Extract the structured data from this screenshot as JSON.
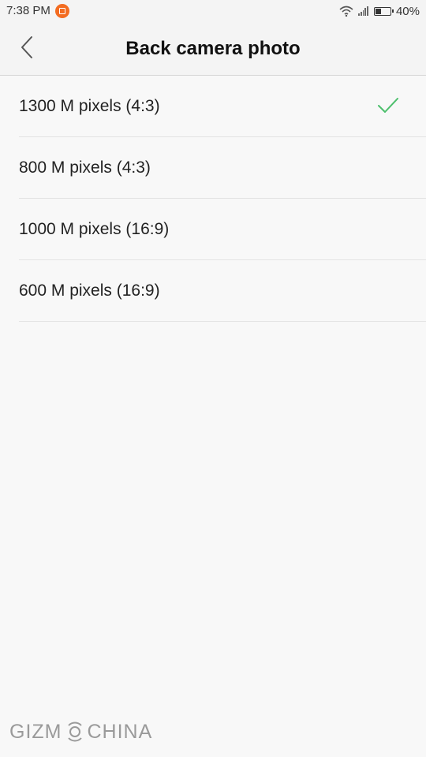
{
  "status_bar": {
    "time": "7:38 PM",
    "notification_icon": "app-notification-icon",
    "battery_percent_label": "40%",
    "battery_level": 0.4
  },
  "header": {
    "back_icon": "chevron-left-icon",
    "title": "Back camera photo"
  },
  "options": [
    {
      "label": "1300 M pixels (4:3)",
      "selected": true
    },
    {
      "label": "800 M pixels (4:3)",
      "selected": false
    },
    {
      "label": "1000 M pixels (16:9)",
      "selected": false
    },
    {
      "label": "600 M pixels (16:9)",
      "selected": false
    }
  ],
  "colors": {
    "check": "#4cbf6c",
    "notification": "#f36c21"
  },
  "watermark": {
    "text_left": "GIZM",
    "text_right": "CHINA"
  }
}
